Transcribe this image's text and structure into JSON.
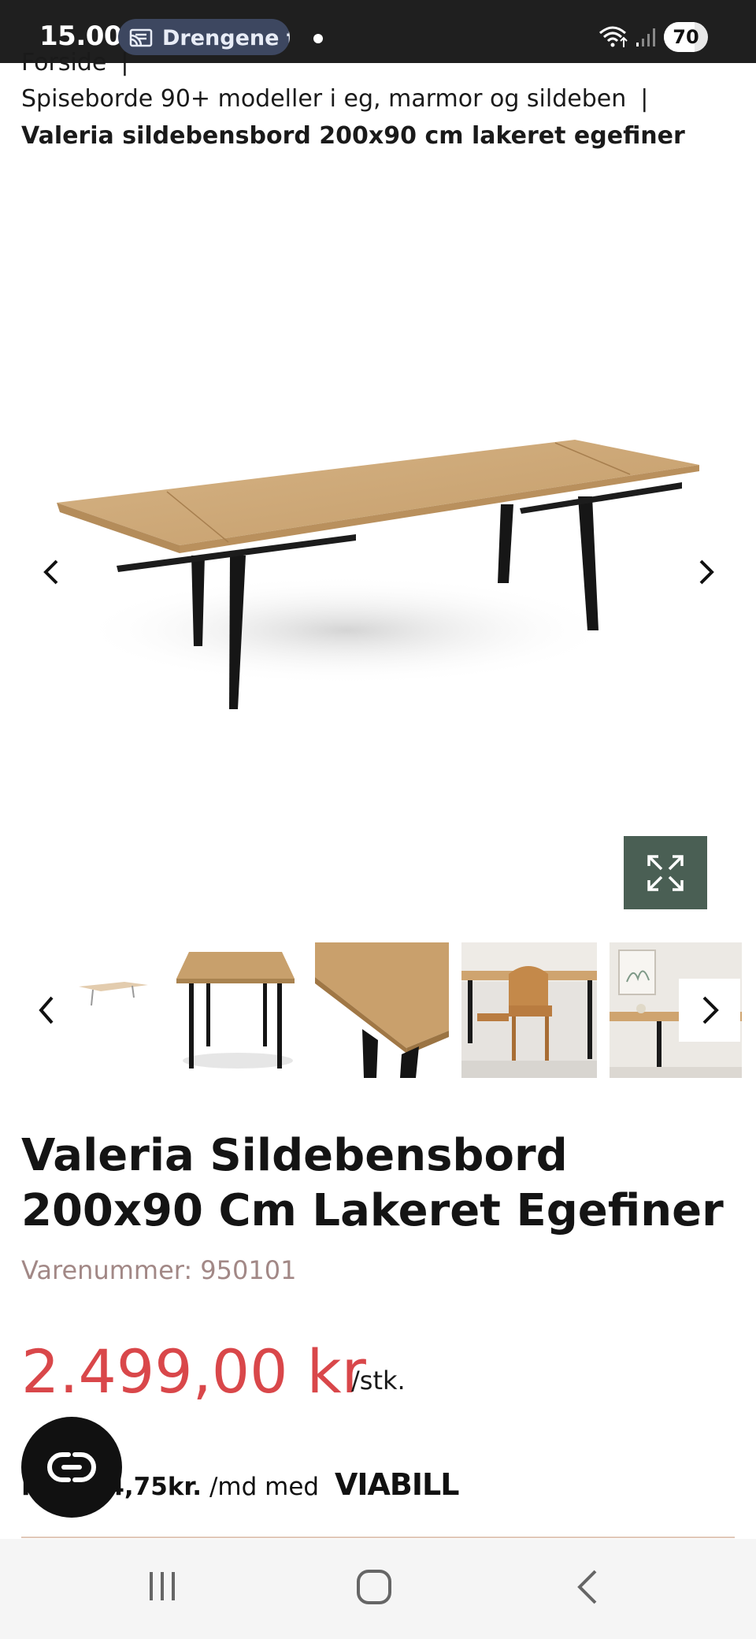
{
  "status_bar": {
    "time": "15.00",
    "cast_label": "Drengene f",
    "battery": "70",
    "battery_level": 0.7
  },
  "breadcrumb": {
    "item1": "Forside",
    "item2": "Spiseborde 90+ modeller i eg, marmor og sildeben",
    "item3": "Valeria sildebensbord 200x90 cm lakeret egefiner",
    "separator": "|"
  },
  "product": {
    "title": "Valeria Sildebensbord 200x90 Cm Lakeret Egefiner",
    "sku": "Varenummer: 950101",
    "price": "2.499,00 kr",
    "unit": "/stk.",
    "finance_amount": "Fra 104,75kr.",
    "finance_suffix": "/md med",
    "finance_brand": "VIABILL"
  },
  "gallery": {
    "thumbnails": [
      "table-extended",
      "table-front",
      "table-corner",
      "dining-room-chairs",
      "dining-room-wall"
    ]
  },
  "colors": {
    "accent_dark_green": "#4a5f54",
    "price_red": "#d9474a",
    "sku_muted": "#a28886",
    "wood": "#caa677"
  }
}
